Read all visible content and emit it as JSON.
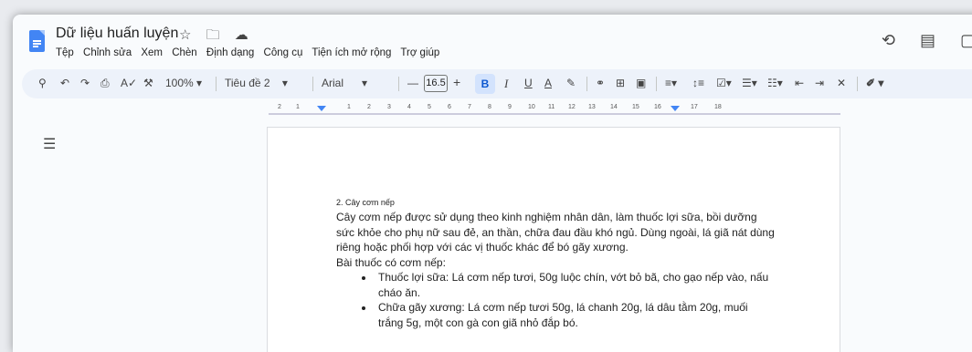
{
  "app": {
    "title": "Dữ liệu huấn luyện",
    "title_icons": "☆ 🗀 ☁",
    "menu": [
      "Tệp",
      "Chỉnh sửa",
      "Xem",
      "Chèn",
      "Định dạng",
      "Công cụ",
      "Tiện ích mở rộng",
      "Trợ giúp"
    ],
    "right_icons": {
      "history": "⟲",
      "comment": "▤",
      "meet": "▢·"
    }
  },
  "toolbar": {
    "zoom": "100%",
    "style": "Tiêu đề 2",
    "font": "Arial",
    "font_size": "16.5",
    "bold": "B",
    "italic": "I",
    "underline": "U",
    "text_color": "A",
    "minus": "—",
    "plus": "+"
  },
  "ruler": [
    "2",
    "1",
    "1",
    "2",
    "3",
    "4",
    "5",
    "6",
    "7",
    "8",
    "9",
    "10",
    "11",
    "12",
    "13",
    "14",
    "15",
    "16",
    "17",
    "18"
  ],
  "document": {
    "heading": "2. Cây cơm nếp",
    "paragraph": "Cây cơm nếp được sử dụng theo kinh nghiệm nhân dân, làm thuốc lợi sữa, bồi dưỡng sức khỏe cho phụ nữ sau đẻ, an thần, chữa đau đầu khó ngủ. Dùng ngoài, lá giã nát dùng riêng hoặc phối hợp với các vị thuốc khác để bó gãy xương.",
    "list_title": "Bài thuốc có cơm nếp:",
    "items": [
      "Thuốc lợi sữa: Lá cơm nếp tươi, 50g luộc chín, vớt bỏ bã, cho gạo nếp vào, nấu cháo ăn.",
      "Chữa gãy xương: Lá cơm nếp tươi 50g, lá chanh 20g, lá dâu tằm 20g, muối trắng 5g, một con gà con giã nhỏ đắp bó."
    ]
  }
}
